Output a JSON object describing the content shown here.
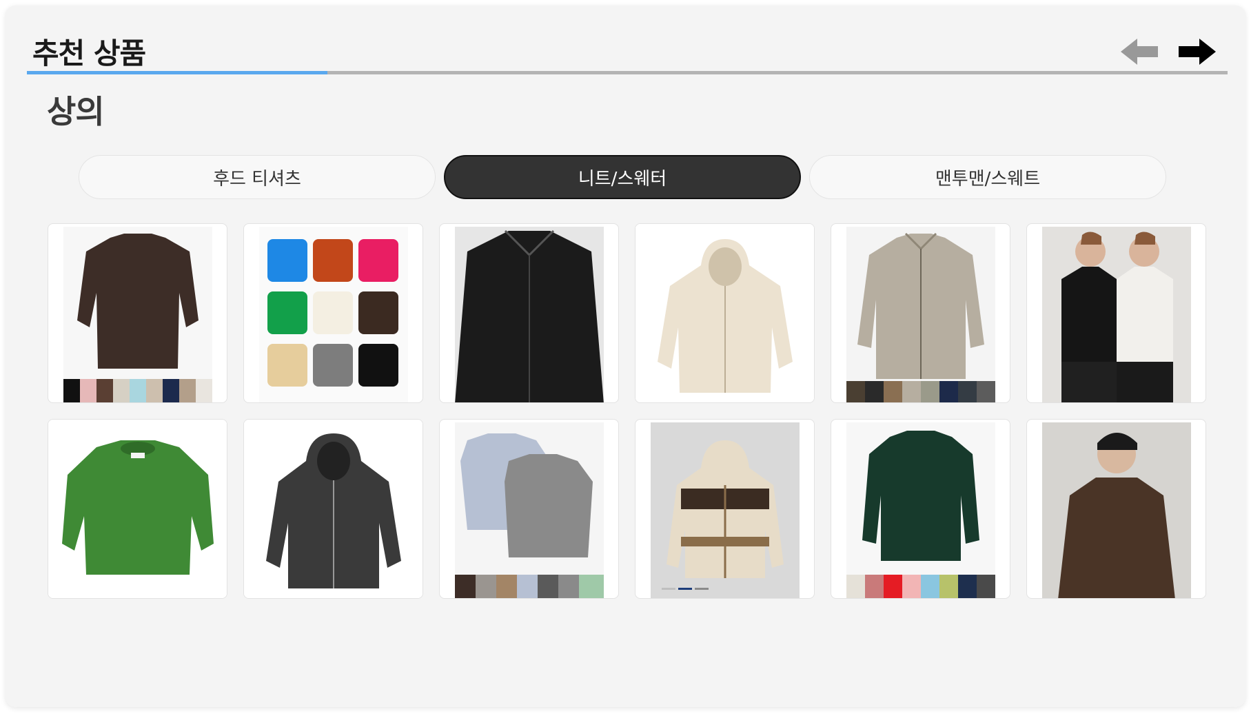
{
  "section_title": "추천 상품",
  "progress": {
    "value": 0.25,
    "fill_color": "#5aa8ee",
    "track_color": "#b3b3b3"
  },
  "nav": {
    "prev_icon": "arrow-left-icon",
    "next_icon": "arrow-right-icon",
    "prev_color": "#999999",
    "next_color": "#000000"
  },
  "category_title": "상의",
  "tabs": [
    {
      "label": "후드 티셔츠",
      "active": false
    },
    {
      "label": "니트/스웨터",
      "active": true
    },
    {
      "label": "맨투맨/스웨트",
      "active": false
    }
  ],
  "products": [
    {
      "name": "brown-crewneck-sweater",
      "colors": [
        "#3d2d27"
      ]
    },
    {
      "name": "multicolor-cable-knit-set",
      "colors": [
        "#1e88e5",
        "#c2471a",
        "#e91e63",
        "#12a04a",
        "#f4efe2",
        "#3b2a21",
        "#e6cd9c",
        "#7d7d7d",
        "#111111"
      ]
    },
    {
      "name": "black-cable-collar-cardigan",
      "colors": [
        "#1b1b1b"
      ]
    },
    {
      "name": "cream-cable-knit-hoodie",
      "colors": [
        "#ece2d0"
      ]
    },
    {
      "name": "beige-zip-collar-knit",
      "colors": [
        "#b6aea0"
      ]
    },
    {
      "name": "mock-neck-knit-models",
      "colors": [
        "#151515",
        "#f2f0ec"
      ]
    },
    {
      "name": "green-mohair-sweater",
      "colors": [
        "#3f8a35"
      ]
    },
    {
      "name": "charcoal-cable-zip-hoodie",
      "colors": [
        "#3a3a3a"
      ]
    },
    {
      "name": "grey-blue-crewneck-set",
      "colors": [
        "#b6c0d3",
        "#8a8a8a"
      ]
    },
    {
      "name": "nordic-pattern-hood-cardigan",
      "colors": [
        "#e7dcc8",
        "#3b2c22"
      ]
    },
    {
      "name": "dark-green-cable-sweater",
      "colors": [
        "#173a2c"
      ]
    },
    {
      "name": "brown-rib-knit-model",
      "colors": [
        "#4a3426"
      ]
    }
  ]
}
